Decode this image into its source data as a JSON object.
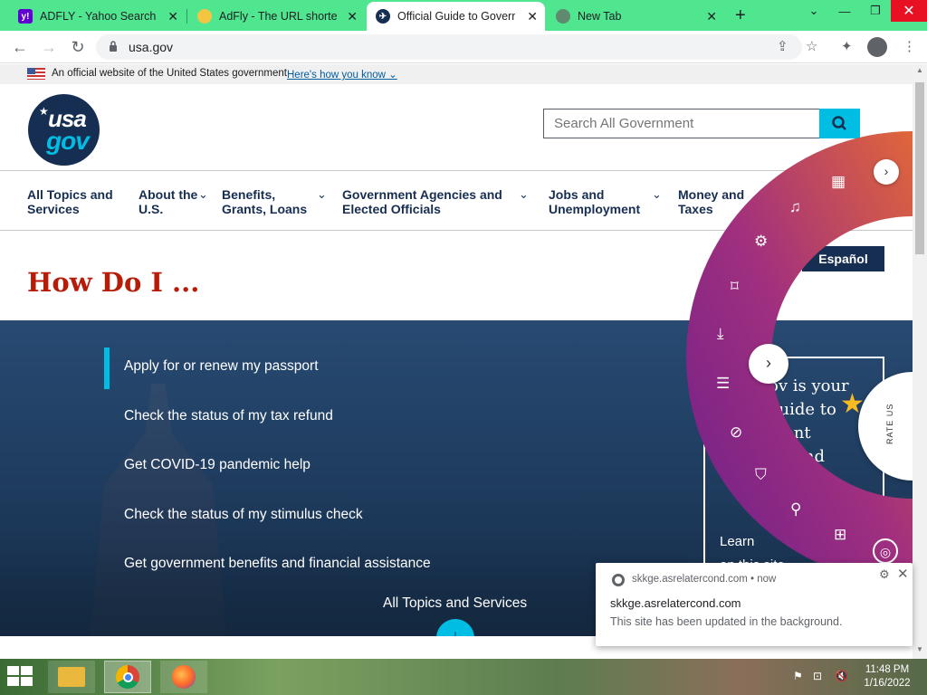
{
  "browser": {
    "tabs": [
      {
        "title": "ADFLY - Yahoo Search Re",
        "favicon": "yahoo-icon"
      },
      {
        "title": "AdFly - The URL shortene",
        "favicon": "adfly-icon"
      },
      {
        "title": "Official Guide to Governme",
        "favicon": "usagov-icon"
      },
      {
        "title": "New Tab",
        "favicon": "globe-icon"
      }
    ],
    "url": "usa.gov"
  },
  "gov_banner": {
    "text": "An official website of the United States government",
    "link": "Here's how you know"
  },
  "logo": {
    "line1": "usa",
    "line2": "gov"
  },
  "search": {
    "placeholder": "Search All Government"
  },
  "nav": [
    {
      "label": "All Topics and Services"
    },
    {
      "label": "About the U.S."
    },
    {
      "label": "Benefits, Grants, Loans"
    },
    {
      "label": "Government Agencies and Elected Officials"
    },
    {
      "label": "Jobs and Unemployment"
    },
    {
      "label": "Money and Taxes"
    }
  ],
  "espanol": "Español",
  "heading": "How Do I ...",
  "hero": {
    "links": [
      "Apply for or renew my passport",
      "Check the status of my tax refund",
      "Get COVID-19 pandemic help",
      "Check the status of my stimulus check",
      "Get government benefits and financial assistance"
    ],
    "all_topics": "All Topics and Services",
    "card_lines": [
      "ov is your",
      "guide to",
      "ment",
      "on and"
    ],
    "learn_lines": [
      "Learn",
      "on this site"
    ]
  },
  "rate_us": "RATE US",
  "notification": {
    "origin": "skkge.asrelatercond.com",
    "time": "now",
    "title": "skkge.asrelatercond.com",
    "body": "This site has been updated in the background."
  },
  "clock": {
    "time": "11:48 PM",
    "date": "1/16/2022"
  }
}
